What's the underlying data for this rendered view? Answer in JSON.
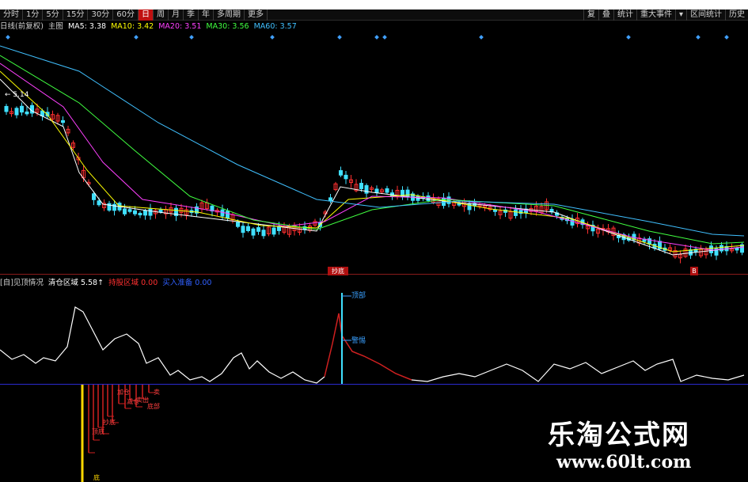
{
  "toolbar": {
    "tabs": [
      {
        "label": "分时"
      },
      {
        "label": "1分"
      },
      {
        "label": "5分"
      },
      {
        "label": "15分"
      },
      {
        "label": "30分"
      },
      {
        "label": "60分"
      },
      {
        "label": "日"
      },
      {
        "label": "周"
      },
      {
        "label": "月"
      },
      {
        "label": "季"
      },
      {
        "label": "年"
      },
      {
        "label": "多周期"
      },
      {
        "label": "更多"
      }
    ],
    "active_tab": "日",
    "right_tools": [
      {
        "label": "复"
      },
      {
        "label": "叠"
      },
      {
        "label": "统计"
      },
      {
        "label": "重大事件"
      },
      {
        "label": "▾"
      },
      {
        "label": "区间统计"
      },
      {
        "label": "历史"
      }
    ]
  },
  "ma_legend": {
    "prefix": "日线(前复权)",
    "subject": "主图",
    "items": [
      {
        "label": "MA5: 3.38",
        "color": "#ffffff"
      },
      {
        "label": "MA10: 3.42",
        "color": "#ffff00"
      },
      {
        "label": "MA20: 3.51",
        "color": "#ff40ff"
      },
      {
        "label": "MA30: 3.56",
        "color": "#40ff40"
      },
      {
        "label": "MA60: 3.57",
        "color": "#40c0ff"
      }
    ]
  },
  "price_panel": {
    "high_marker": "5.14",
    "signal_flag_1": "抄底",
    "signal_flag_2": "B"
  },
  "indicator_legend": {
    "title": "[自]见顶情况",
    "items": [
      {
        "label": "清仓区域 5.58↑",
        "color": "#ffffff"
      },
      {
        "label": "持股区域 0.00",
        "color": "#ff3030"
      },
      {
        "label": "买入准备 0.00",
        "color": "#3060ff"
      }
    ]
  },
  "indicator_panel": {
    "peak_label": "顶部",
    "mid_label": "警惕"
  },
  "bottom_panel": {
    "bar_labels": [
      "顶底",
      "抄底",
      "加仓",
      "减仓",
      "卖出",
      "底部",
      "卖",
      "底"
    ]
  },
  "watermark": {
    "title": "乐淘公式网",
    "url": "www.60lt.com"
  },
  "colors": {
    "up_candle": "#ff3030",
    "down_candle": "#40e0ff",
    "background": "#000000",
    "active_tab": "#c01010"
  }
}
